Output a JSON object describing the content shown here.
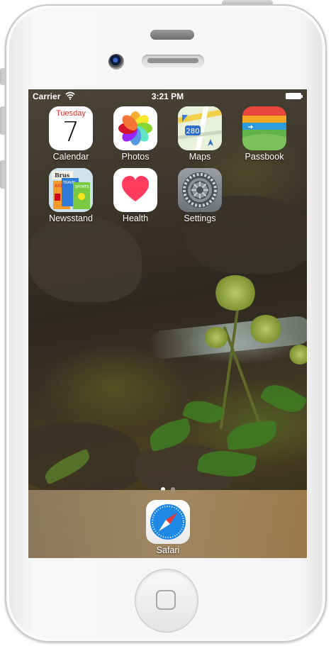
{
  "status_bar": {
    "carrier": "Carrier",
    "time": "3:21 PM"
  },
  "apps": {
    "calendar": {
      "label": "Calendar",
      "weekday": "Tuesday",
      "day": "7"
    },
    "photos": {
      "label": "Photos"
    },
    "maps": {
      "label": "Maps",
      "shield": "280"
    },
    "passbook": {
      "label": "Passbook"
    },
    "newsstand": {
      "label": "Newsstand",
      "masthead": "Brus",
      "tags": [
        "ART",
        "TRAVEL",
        "SPORTS"
      ]
    },
    "health": {
      "label": "Health"
    },
    "settings": {
      "label": "Settings"
    }
  },
  "page_indicator": {
    "pages": 2,
    "current": 1
  },
  "dock": {
    "safari": {
      "label": "Safari"
    }
  },
  "colors": {
    "calendar_red": "#e0342f",
    "health_heart": "#ff3b5f",
    "safari_blue": "#1e88e5"
  },
  "icons": [
    "wifi-icon",
    "battery-icon",
    "calendar-icon",
    "photos-icon",
    "maps-icon",
    "passbook-icon",
    "newsstand-icon",
    "health-icon",
    "settings-icon",
    "safari-icon",
    "home-button-icon"
  ]
}
